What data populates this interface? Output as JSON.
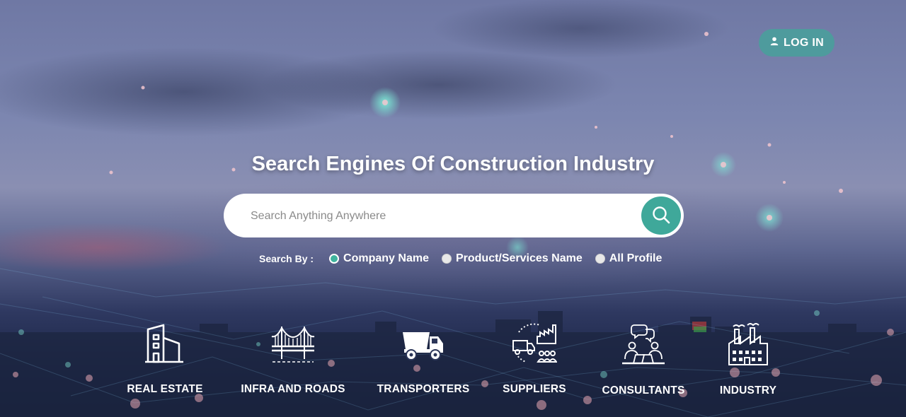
{
  "header": {
    "login_label": "LOG IN",
    "login_icon": "user-icon"
  },
  "hero": {
    "title": "Search Engines Of Construction Industry"
  },
  "search": {
    "placeholder": "Search Anything Anywhere",
    "button_icon": "search-icon",
    "search_by_label": "Search By :",
    "options": [
      {
        "label": "Company Name",
        "selected": true
      },
      {
        "label": "Product/Services Name",
        "selected": false
      },
      {
        "label": "All Profile",
        "selected": false
      }
    ]
  },
  "categories": [
    {
      "label": "REAL ESTATE",
      "icon": "building-icon"
    },
    {
      "label": "INFRA AND ROADS",
      "icon": "bridge-icon"
    },
    {
      "label": "TRANSPORTERS",
      "icon": "dump-truck-icon"
    },
    {
      "label": "SUPPLIERS",
      "icon": "suppliers-icon"
    },
    {
      "label": "CONSULTANTS",
      "icon": "consultants-icon"
    },
    {
      "label": "INDUSTRY",
      "icon": "factory-icon"
    }
  ],
  "colors": {
    "accent": "#3fa89a",
    "login_bg": "#4e9b9d",
    "radio_selected": "#3fb39e"
  }
}
